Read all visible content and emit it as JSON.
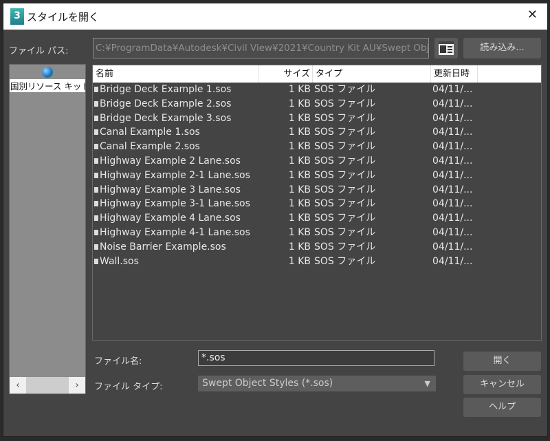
{
  "dialog": {
    "title": "スタイルを開く",
    "logo": "3"
  },
  "path": {
    "label": "ファイル パス:",
    "value": "C:¥ProgramData¥Autodesk¥Civil View¥2021¥Country Kit AU¥Swept Obje",
    "read_button": "読み込み..."
  },
  "sidebar": {
    "item": "国別リソース キット"
  },
  "columns": {
    "name": "名前",
    "size": "サイズ",
    "type": "タイプ",
    "date": "更新日時"
  },
  "files": [
    {
      "name": "Bridge Deck Example 1.sos",
      "size": "1 KB",
      "type": "SOS ファイル",
      "date": "04/11/..."
    },
    {
      "name": "Bridge Deck Example 2.sos",
      "size": "1 KB",
      "type": "SOS ファイル",
      "date": "04/11/..."
    },
    {
      "name": "Bridge Deck Example 3.sos",
      "size": "1 KB",
      "type": "SOS ファイル",
      "date": "04/11/..."
    },
    {
      "name": "Canal Example 1.sos",
      "size": "1 KB",
      "type": "SOS ファイル",
      "date": "04/11/..."
    },
    {
      "name": "Canal Example 2.sos",
      "size": "1 KB",
      "type": "SOS ファイル",
      "date": "04/11/..."
    },
    {
      "name": "Highway Example 2 Lane.sos",
      "size": "1 KB",
      "type": "SOS ファイル",
      "date": "04/11/..."
    },
    {
      "name": "Highway Example 2-1 Lane.sos",
      "size": "1 KB",
      "type": "SOS ファイル",
      "date": "04/11/..."
    },
    {
      "name": "Highway Example 3 Lane.sos",
      "size": "1 KB",
      "type": "SOS ファイル",
      "date": "04/11/..."
    },
    {
      "name": "Highway Example 3-1 Lane.sos",
      "size": "1 KB",
      "type": "SOS ファイル",
      "date": "04/11/..."
    },
    {
      "name": "Highway Example 4 Lane.sos",
      "size": "1 KB",
      "type": "SOS ファイル",
      "date": "04/11/..."
    },
    {
      "name": "Highway Example 4-1 Lane.sos",
      "size": "1 KB",
      "type": "SOS ファイル",
      "date": "04/11/..."
    },
    {
      "name": "Noise Barrier Example.sos",
      "size": "1 KB",
      "type": "SOS ファイル",
      "date": "04/11/..."
    },
    {
      "name": "Wall.sos",
      "size": "1 KB",
      "type": "SOS ファイル",
      "date": "04/11/..."
    }
  ],
  "filename": {
    "label": "ファイル名:",
    "value": "*.sos"
  },
  "filetype": {
    "label": "ファイル タイプ:",
    "value": "Swept Object Styles (*.sos)"
  },
  "buttons": {
    "open": "開く",
    "cancel": "キャンセル",
    "help": "ヘルプ"
  }
}
